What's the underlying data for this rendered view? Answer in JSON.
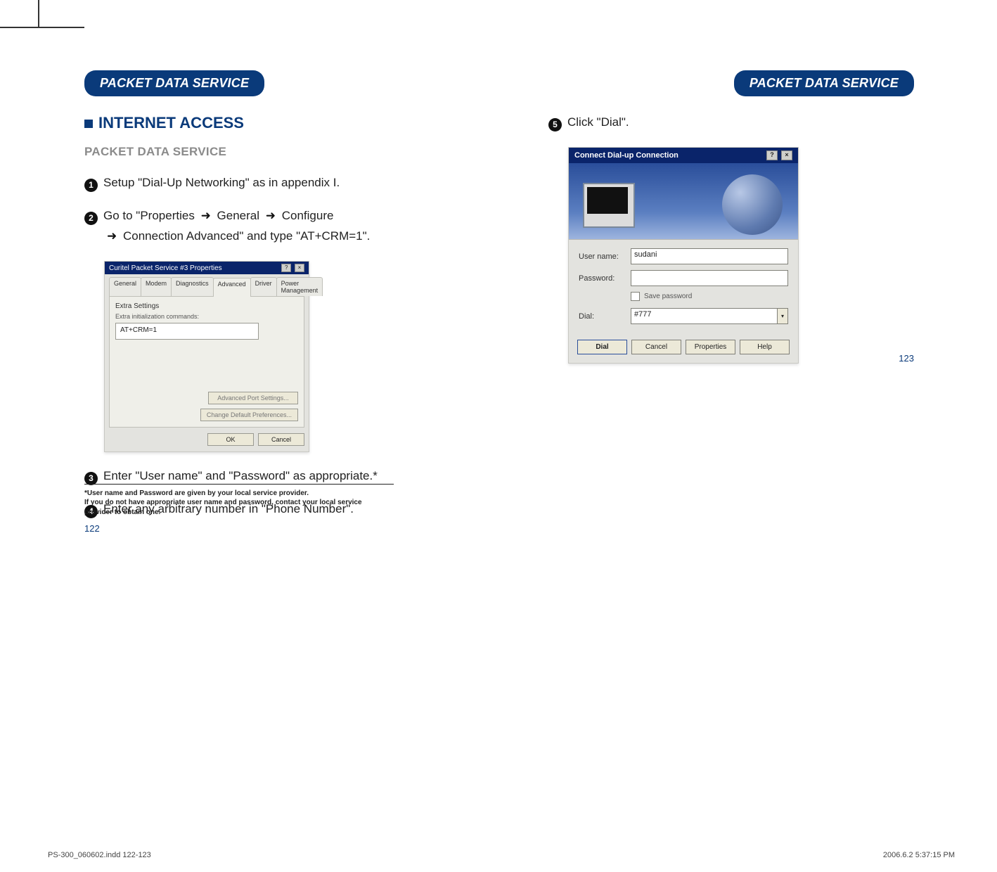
{
  "header": {
    "left_badge": "PACKET DATA SERVICE",
    "right_badge": "PACKET DATA SERVICE"
  },
  "section": {
    "title": "INTERNET ACCESS",
    "subtitle": "PACKET DATA SERVICE"
  },
  "steps": {
    "s1": "Setup \"Dial-Up Networking\" as in appendix I.",
    "s2a": "Go to \"Properties",
    "s2b": "General",
    "s2c": "Configure",
    "s2d": "Connection   Advanced\" and type \"AT+CRM=1\".",
    "s3": "Enter \"User name\" and \"Password\" as appropriate.*",
    "s4": "Enter any arbitrary number in \"Phone Number\".",
    "s5": "Click \"Dial\"."
  },
  "shot1": {
    "title": "Curitel Packet Service #3 Properties",
    "tabs": [
      "General",
      "Modem",
      "Diagnostics",
      "Advanced",
      "Driver",
      "Power Management"
    ],
    "group": "Extra Settings",
    "hint": "Extra initialization commands:",
    "value": "AT+CRM=1",
    "btn_adv": "Advanced Port Settings...",
    "btn_def": "Change Default Preferences...",
    "ok": "OK",
    "cancel": "Cancel"
  },
  "shot2": {
    "title": "Connect Dial-up Connection",
    "lbl_user": "User name:",
    "val_user": "sudani",
    "lbl_pass": "Password:",
    "val_pass": "",
    "save_pw": "Save password",
    "lbl_dial": "Dial:",
    "val_dial": "#777",
    "btn_dial": "Dial",
    "btn_cancel": "Cancel",
    "btn_props": "Properties",
    "btn_help": "Help"
  },
  "footnote_lines": [
    "*User name and Password are given by your local service provider.",
    "  If you do not have appropriate user name and password, contact your local service",
    "  provider to obtain one."
  ],
  "page_left": "122",
  "page_right": "123",
  "print_left": "PS-300_060602.indd   122-123",
  "print_right": "2006.6.2   5:37:15 PM"
}
